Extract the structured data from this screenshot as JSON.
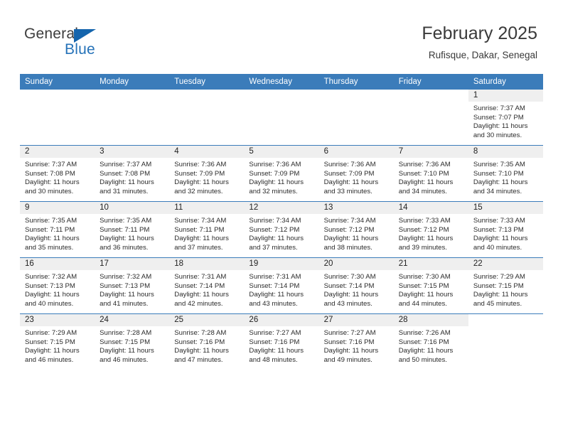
{
  "brand": {
    "name_part1": "General",
    "name_part2": "Blue",
    "flag_icon": "triangle-flag-icon",
    "accent_color": "#1565ad",
    "blue_text_color": "#2572b8"
  },
  "header": {
    "month_title": "February 2025",
    "location": "Rufisque, Dakar, Senegal",
    "header_bg_color": "#3b7cba",
    "daynum_band_color": "#efefef"
  },
  "weekday_headers": [
    "Sunday",
    "Monday",
    "Tuesday",
    "Wednesday",
    "Thursday",
    "Friday",
    "Saturday"
  ],
  "labels": {
    "sunrise_prefix": "Sunrise:",
    "sunset_prefix": "Sunset:",
    "daylight_prefix": "Daylight:"
  },
  "weeks": [
    [
      {
        "day": "",
        "blank": true
      },
      {
        "day": "",
        "blank": true
      },
      {
        "day": "",
        "blank": true
      },
      {
        "day": "",
        "blank": true
      },
      {
        "day": "",
        "blank": true
      },
      {
        "day": "",
        "blank": true
      },
      {
        "day": "1",
        "sunrise": "Sunrise: 7:37 AM",
        "sunset": "Sunset: 7:07 PM",
        "daylight_line1": "Daylight: 11 hours",
        "daylight_line2": "and 30 minutes."
      }
    ],
    [
      {
        "day": "2",
        "sunrise": "Sunrise: 7:37 AM",
        "sunset": "Sunset: 7:08 PM",
        "daylight_line1": "Daylight: 11 hours",
        "daylight_line2": "and 30 minutes."
      },
      {
        "day": "3",
        "sunrise": "Sunrise: 7:37 AM",
        "sunset": "Sunset: 7:08 PM",
        "daylight_line1": "Daylight: 11 hours",
        "daylight_line2": "and 31 minutes."
      },
      {
        "day": "4",
        "sunrise": "Sunrise: 7:36 AM",
        "sunset": "Sunset: 7:09 PM",
        "daylight_line1": "Daylight: 11 hours",
        "daylight_line2": "and 32 minutes."
      },
      {
        "day": "5",
        "sunrise": "Sunrise: 7:36 AM",
        "sunset": "Sunset: 7:09 PM",
        "daylight_line1": "Daylight: 11 hours",
        "daylight_line2": "and 32 minutes."
      },
      {
        "day": "6",
        "sunrise": "Sunrise: 7:36 AM",
        "sunset": "Sunset: 7:09 PM",
        "daylight_line1": "Daylight: 11 hours",
        "daylight_line2": "and 33 minutes."
      },
      {
        "day": "7",
        "sunrise": "Sunrise: 7:36 AM",
        "sunset": "Sunset: 7:10 PM",
        "daylight_line1": "Daylight: 11 hours",
        "daylight_line2": "and 34 minutes."
      },
      {
        "day": "8",
        "sunrise": "Sunrise: 7:35 AM",
        "sunset": "Sunset: 7:10 PM",
        "daylight_line1": "Daylight: 11 hours",
        "daylight_line2": "and 34 minutes."
      }
    ],
    [
      {
        "day": "9",
        "sunrise": "Sunrise: 7:35 AM",
        "sunset": "Sunset: 7:11 PM",
        "daylight_line1": "Daylight: 11 hours",
        "daylight_line2": "and 35 minutes."
      },
      {
        "day": "10",
        "sunrise": "Sunrise: 7:35 AM",
        "sunset": "Sunset: 7:11 PM",
        "daylight_line1": "Daylight: 11 hours",
        "daylight_line2": "and 36 minutes."
      },
      {
        "day": "11",
        "sunrise": "Sunrise: 7:34 AM",
        "sunset": "Sunset: 7:11 PM",
        "daylight_line1": "Daylight: 11 hours",
        "daylight_line2": "and 37 minutes."
      },
      {
        "day": "12",
        "sunrise": "Sunrise: 7:34 AM",
        "sunset": "Sunset: 7:12 PM",
        "daylight_line1": "Daylight: 11 hours",
        "daylight_line2": "and 37 minutes."
      },
      {
        "day": "13",
        "sunrise": "Sunrise: 7:34 AM",
        "sunset": "Sunset: 7:12 PM",
        "daylight_line1": "Daylight: 11 hours",
        "daylight_line2": "and 38 minutes."
      },
      {
        "day": "14",
        "sunrise": "Sunrise: 7:33 AM",
        "sunset": "Sunset: 7:12 PM",
        "daylight_line1": "Daylight: 11 hours",
        "daylight_line2": "and 39 minutes."
      },
      {
        "day": "15",
        "sunrise": "Sunrise: 7:33 AM",
        "sunset": "Sunset: 7:13 PM",
        "daylight_line1": "Daylight: 11 hours",
        "daylight_line2": "and 40 minutes."
      }
    ],
    [
      {
        "day": "16",
        "sunrise": "Sunrise: 7:32 AM",
        "sunset": "Sunset: 7:13 PM",
        "daylight_line1": "Daylight: 11 hours",
        "daylight_line2": "and 40 minutes."
      },
      {
        "day": "17",
        "sunrise": "Sunrise: 7:32 AM",
        "sunset": "Sunset: 7:13 PM",
        "daylight_line1": "Daylight: 11 hours",
        "daylight_line2": "and 41 minutes."
      },
      {
        "day": "18",
        "sunrise": "Sunrise: 7:31 AM",
        "sunset": "Sunset: 7:14 PM",
        "daylight_line1": "Daylight: 11 hours",
        "daylight_line2": "and 42 minutes."
      },
      {
        "day": "19",
        "sunrise": "Sunrise: 7:31 AM",
        "sunset": "Sunset: 7:14 PM",
        "daylight_line1": "Daylight: 11 hours",
        "daylight_line2": "and 43 minutes."
      },
      {
        "day": "20",
        "sunrise": "Sunrise: 7:30 AM",
        "sunset": "Sunset: 7:14 PM",
        "daylight_line1": "Daylight: 11 hours",
        "daylight_line2": "and 43 minutes."
      },
      {
        "day": "21",
        "sunrise": "Sunrise: 7:30 AM",
        "sunset": "Sunset: 7:15 PM",
        "daylight_line1": "Daylight: 11 hours",
        "daylight_line2": "and 44 minutes."
      },
      {
        "day": "22",
        "sunrise": "Sunrise: 7:29 AM",
        "sunset": "Sunset: 7:15 PM",
        "daylight_line1": "Daylight: 11 hours",
        "daylight_line2": "and 45 minutes."
      }
    ],
    [
      {
        "day": "23",
        "sunrise": "Sunrise: 7:29 AM",
        "sunset": "Sunset: 7:15 PM",
        "daylight_line1": "Daylight: 11 hours",
        "daylight_line2": "and 46 minutes."
      },
      {
        "day": "24",
        "sunrise": "Sunrise: 7:28 AM",
        "sunset": "Sunset: 7:15 PM",
        "daylight_line1": "Daylight: 11 hours",
        "daylight_line2": "and 46 minutes."
      },
      {
        "day": "25",
        "sunrise": "Sunrise: 7:28 AM",
        "sunset": "Sunset: 7:16 PM",
        "daylight_line1": "Daylight: 11 hours",
        "daylight_line2": "and 47 minutes."
      },
      {
        "day": "26",
        "sunrise": "Sunrise: 7:27 AM",
        "sunset": "Sunset: 7:16 PM",
        "daylight_line1": "Daylight: 11 hours",
        "daylight_line2": "and 48 minutes."
      },
      {
        "day": "27",
        "sunrise": "Sunrise: 7:27 AM",
        "sunset": "Sunset: 7:16 PM",
        "daylight_line1": "Daylight: 11 hours",
        "daylight_line2": "and 49 minutes."
      },
      {
        "day": "28",
        "sunrise": "Sunrise: 7:26 AM",
        "sunset": "Sunset: 7:16 PM",
        "daylight_line1": "Daylight: 11 hours",
        "daylight_line2": "and 50 minutes."
      },
      {
        "day": "",
        "blank": true
      }
    ]
  ]
}
